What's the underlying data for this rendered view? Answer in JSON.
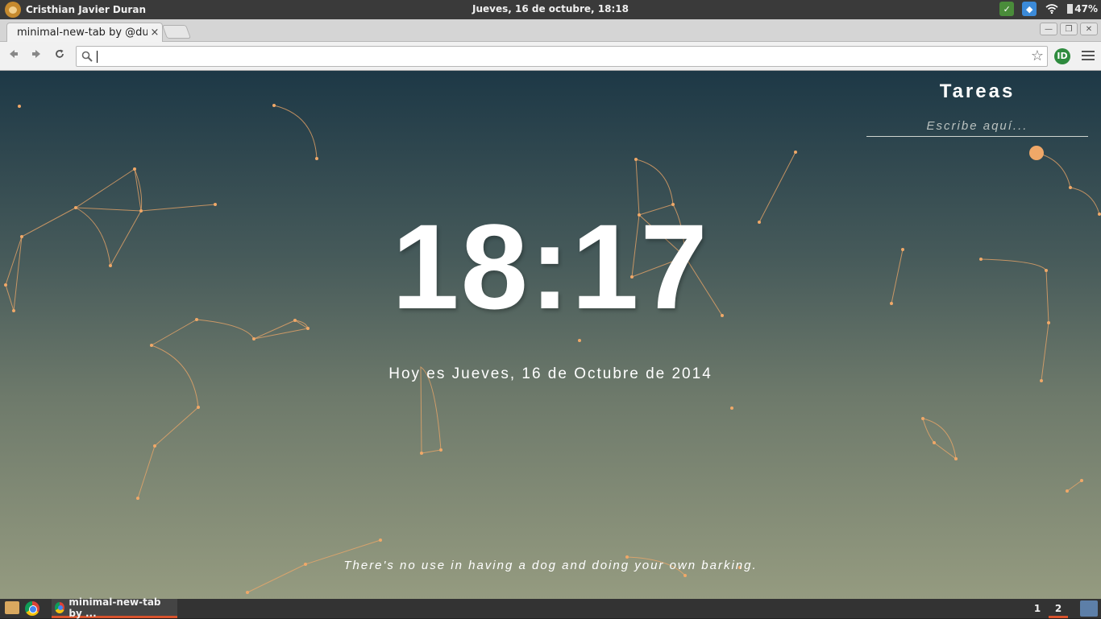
{
  "top_panel": {
    "user_name": "Cristhian Javier Duran",
    "datetime": "Jueves, 16 de octubre, 18:18",
    "battery": "47%"
  },
  "browser": {
    "tab_title": "minimal-new-tab by @du",
    "tab_close": "×",
    "window_buttons": [
      "—",
      "❐",
      "✕"
    ],
    "address_value": "",
    "extension_label": "ID"
  },
  "page": {
    "clock": "18:17",
    "date": "Hoy es Jueves, 16 de Octubre de 2014",
    "quote": "There's no use in having a dog and doing your own barking.",
    "tasks_title": "Tareas",
    "tasks_placeholder": "Escribe aquí..."
  },
  "taskbar": {
    "window_title": "minimal-new-tab by ...",
    "workspaces": [
      "1",
      "2"
    ],
    "active_workspace": "2"
  },
  "colors": {
    "constellation": "#f0a868",
    "accent": "#d8522d"
  }
}
